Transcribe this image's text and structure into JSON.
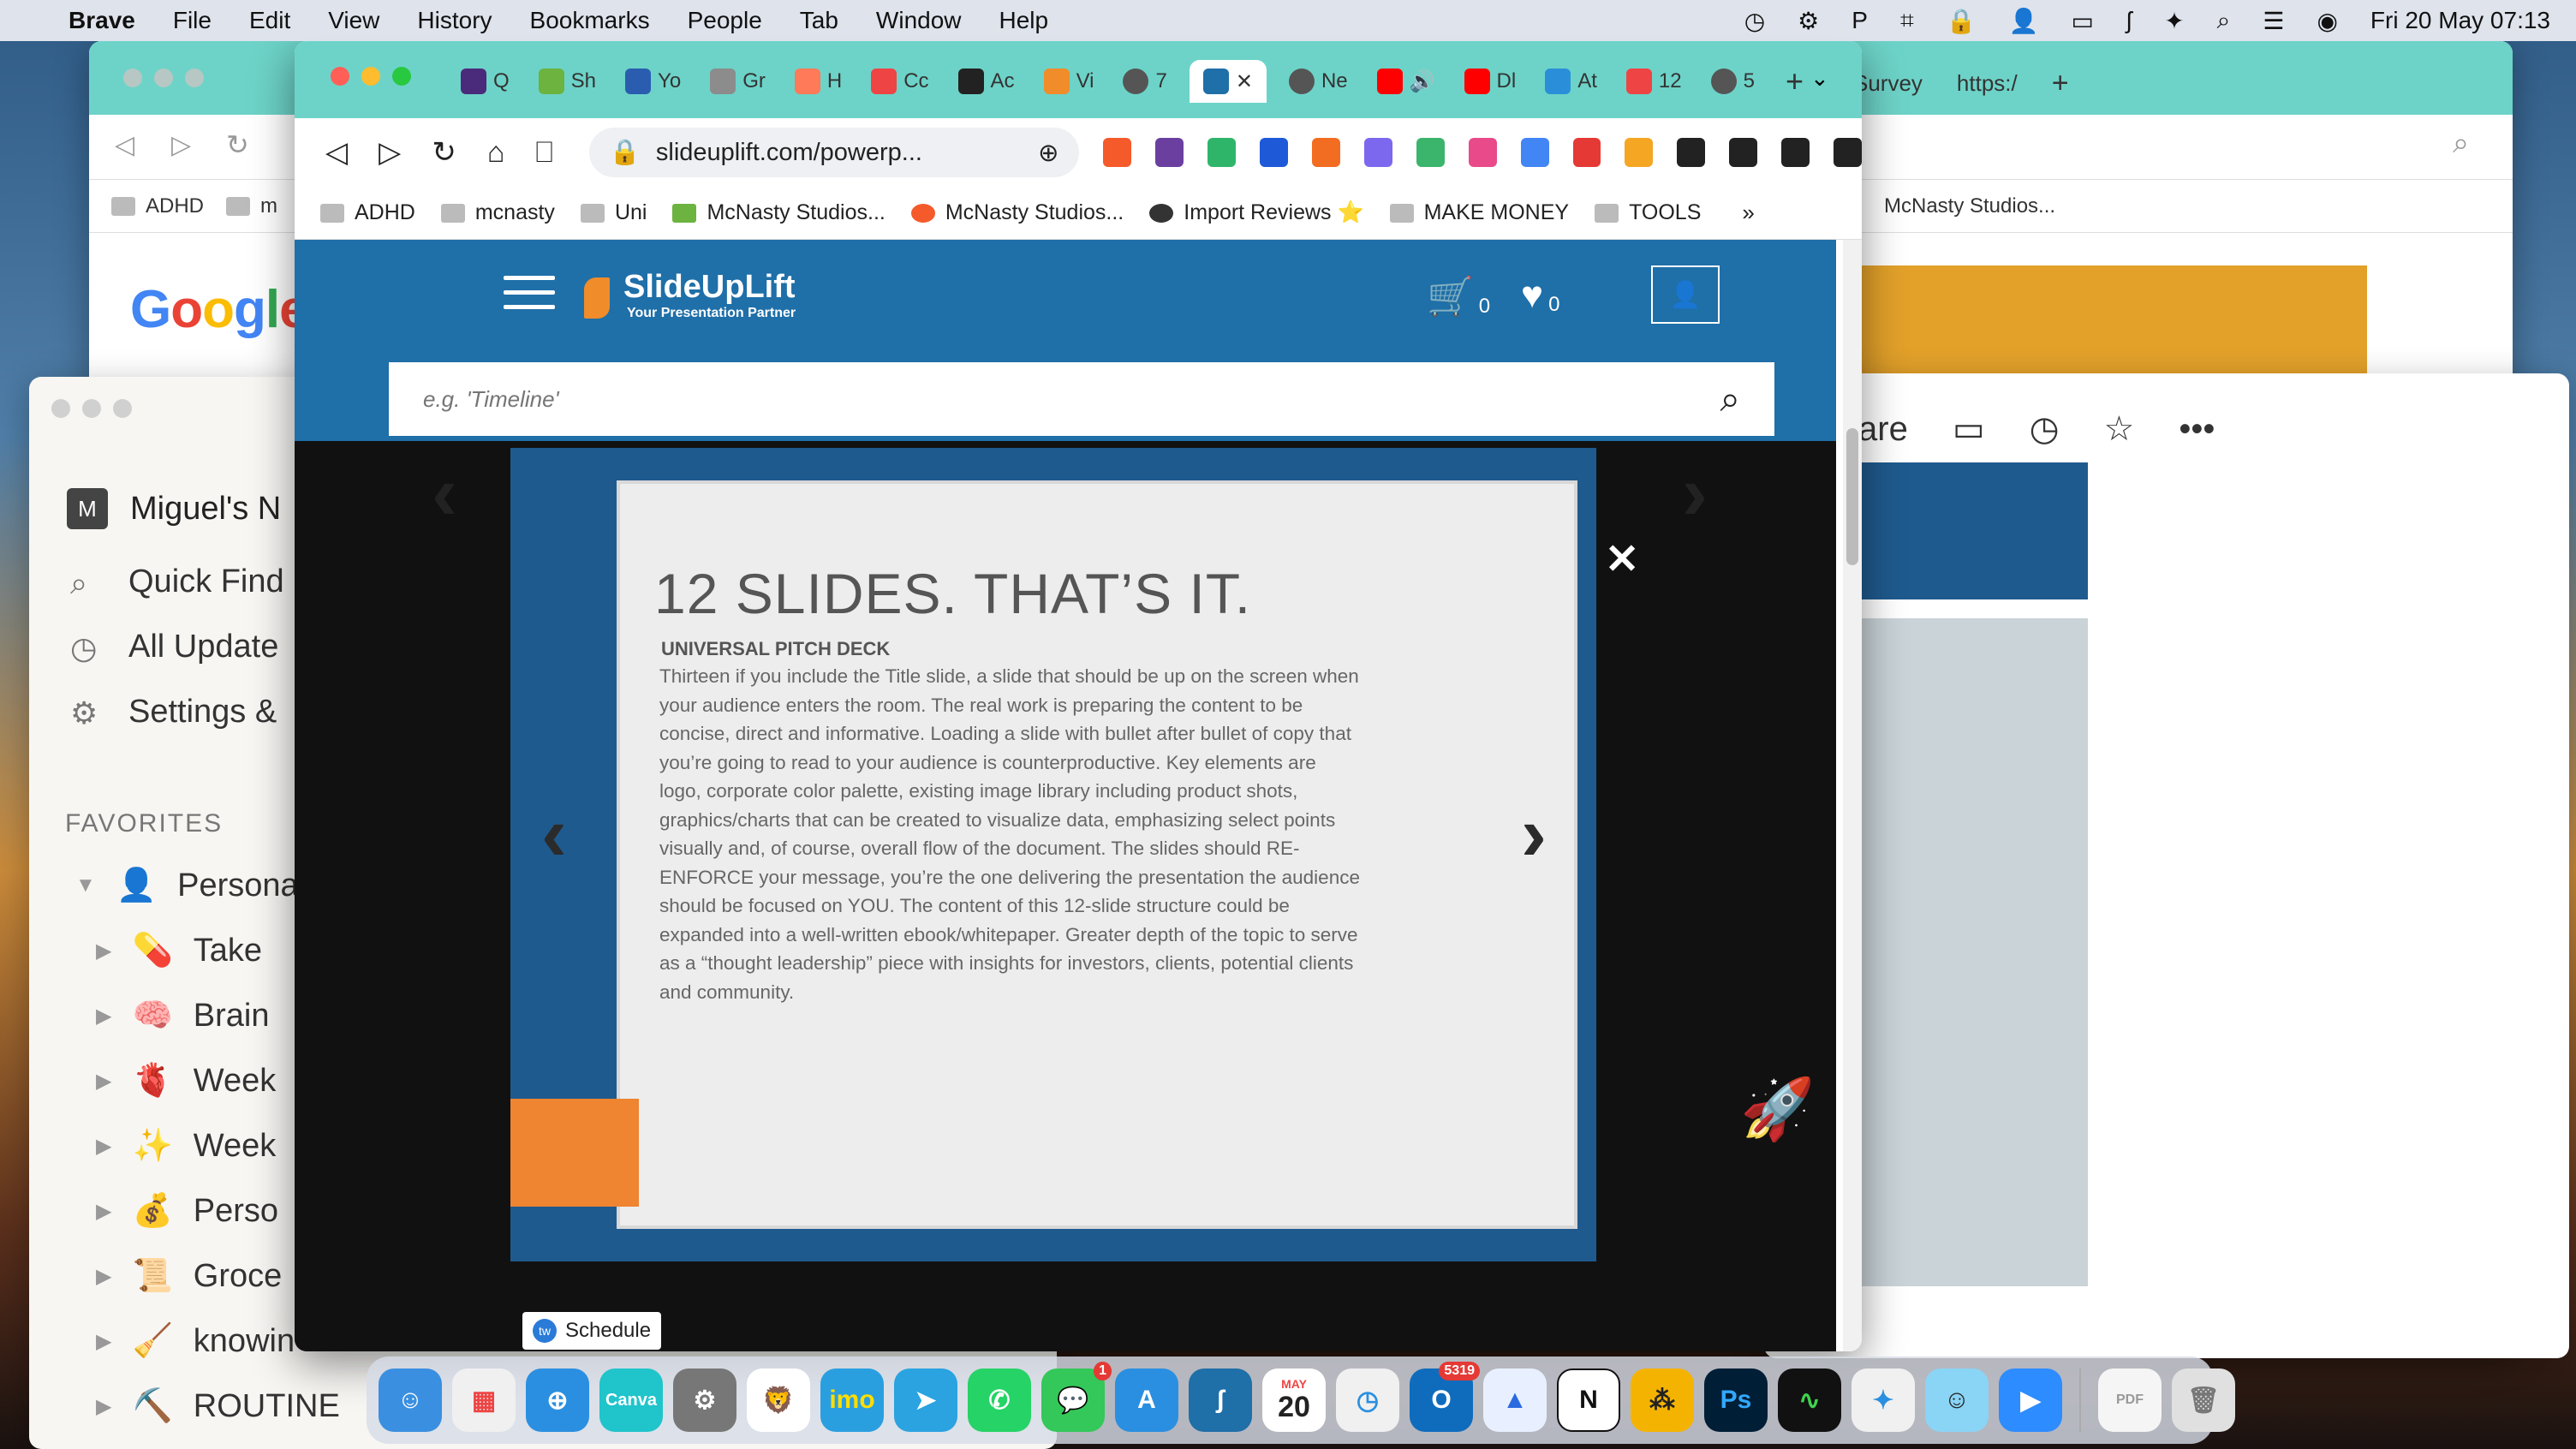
{
  "menubar": {
    "app": "Brave",
    "items": [
      "File",
      "Edit",
      "View",
      "History",
      "Bookmarks",
      "People",
      "Tab",
      "Window",
      "Help"
    ],
    "clock": "Fri 20 May  07:13"
  },
  "back_window": {
    "bookmarks": [
      "ADHD",
      "m"
    ],
    "right_tabs": [
      "Survey",
      "https:/"
    ],
    "right_bookmark": "McNasty Studios...",
    "logo": "Google"
  },
  "notion": {
    "workspace": "Miguel's N",
    "avatar_letter": "M",
    "nav": [
      "Quick Find",
      "All Update",
      "Settings &"
    ],
    "favorites_label": "FAVORITES",
    "favorites": [
      {
        "emoji": "👤",
        "label": "Persona"
      },
      {
        "emoji": "💊",
        "label": "Take "
      },
      {
        "emoji": "🧠",
        "label": "Brain "
      },
      {
        "emoji": "🫀",
        "label": "Week"
      },
      {
        "emoji": "✨",
        "label": "Week"
      },
      {
        "emoji": "💰",
        "label": "Perso"
      },
      {
        "emoji": "📜",
        "label": "Groce"
      },
      {
        "emoji": "🧹",
        "label": "knowin"
      },
      {
        "emoji": "⛏️",
        "label": "ROUTINE"
      }
    ]
  },
  "side_window": {
    "share_label": "are"
  },
  "main_window": {
    "tabs": [
      "Q",
      "Sh",
      "Yo",
      "Gr",
      "H",
      "Cc",
      "Ac",
      "Vi",
      "7",
      "",
      "Ne",
      "",
      "Dl",
      "At",
      "12",
      "5"
    ],
    "url": "slideuplift.com/powerp...",
    "bookmarks": [
      "ADHD",
      "mcnasty",
      "Uni",
      "McNasty Studios...",
      "McNasty Studios...",
      "Import Reviews ⭐",
      "MAKE MONEY",
      "TOOLS"
    ]
  },
  "site": {
    "brand": "SlideUpLift",
    "tagline": "Your Presentation Partner",
    "cart_count": "0",
    "wishlist_count": "0",
    "search_placeholder": "e.g. 'Timeline'",
    "schedule_label": "Schedule",
    "slide": {
      "title": "12 SLIDES. THAT’S IT.",
      "subtitle": "UNIVERSAL PITCH DECK",
      "body": " Thirteen if you include the Title slide, a slide that should be up on the screen when your audience enters the room. The real work is preparing the content to be concise, direct and informative. Loading a slide with bullet after bullet of copy that you’re going to read to your audience is counterproductive. Key elements are logo, corporate color palette, existing image library including product shots, graphics/charts that can be created to visualize data, emphasizing select points visually and, of course, overall flow of the document. The slides should RE-ENFORCE your message, you’re the one delivering the presentation the audience should be focused on YOU. The content of this 12-slide structure could be expanded into a well-written ebook/whitepaper. Greater depth of the topic to serve as a “thought leadership” piece with insights for investors, clients, potential clients and community."
    }
  },
  "dock": {
    "calendar_month": "MAY",
    "calendar_day": "20",
    "messages_badge": "1",
    "outlook_badge": "5319"
  },
  "colors": {
    "brand_blue": "#1f6fa8",
    "brand_orange": "#ef8431",
    "tabbar_teal": "#6dd3c8"
  }
}
